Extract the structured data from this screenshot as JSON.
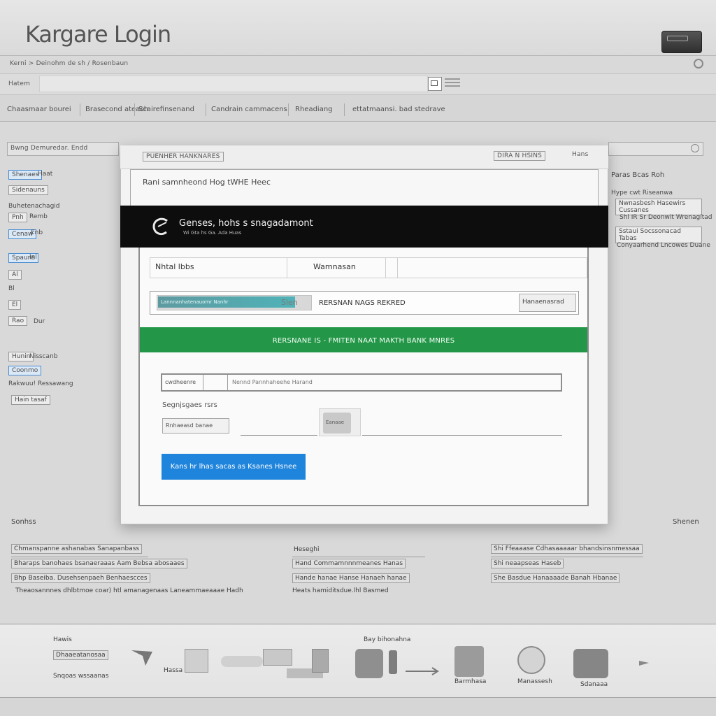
{
  "header": {
    "app_title": "Kargare Login",
    "breadcrumb": "Kerni > Deinohm de sh / Rosenbaun",
    "search_label": "Hatem",
    "search_placeholder": ""
  },
  "nav": {
    "tabs": [
      "Chaasmaar bourei",
      "Brasecond ateach",
      "Scairefinsenand",
      "Candrain cammacens",
      "Rheadiang",
      "ettatmaansi. bad stedrave"
    ]
  },
  "left_sidebar": {
    "filter": "Bwng Demuredar. Endd",
    "items": [
      "Shenaes",
      "Haat",
      "Sidenauns",
      "Buhetenachagid",
      "Pnh",
      "Remb",
      "Cenaw",
      "Enb",
      "Spauns",
      "Inl",
      "Al",
      "Bl",
      "El",
      "Rao",
      "Dur",
      "Hunin",
      "Nisscanb",
      "Coonmo",
      "Rakwuu! Ressawang",
      "Hain tasaf"
    ]
  },
  "right_sidebar": {
    "heading": "Paras Bcas Roh",
    "items": [
      "Hype cwt Riseanwa",
      "Nwnasbesh Hasewirs Cussanes",
      "Shl IR Sr Deonwit Wrenagitad",
      "Sstaui Socssonacad Tabas",
      "Conyaarhend Lncowes Duane"
    ]
  },
  "modal": {
    "tab_label": "PUENHER HANKNARES",
    "mode": "DIRA N HSINS",
    "close_label": "Hans",
    "heading": "Rani samnheond Hog tWHE Heec",
    "brand_name": "Genses, hohs  s  snagadamont",
    "brand_tagline": "Wi Gta hs Ga. Ada Huas",
    "username_label": "Nhtal lbbs",
    "workspace_label": "Wamnasan",
    "progress_text": "Lannnanhatenauomr Nanhr",
    "progress_value": 0.9,
    "progress_pct_label": "Slen",
    "row2_label": "RERSNAN NAGS REKRED",
    "row2_button": "Hanaenasrad",
    "status_text": "RERSNANE IS - FMITEN  NAAT MAKTH BANK MNRES",
    "password_label": "cwdheenre",
    "password_placeholder": "Nennd Pannhaheehe Harand",
    "remember_label": "Segnjsgaes rsrs",
    "remember_field": "Rnhaeasd banae",
    "captcha_text": "Eanaae",
    "login_button": "Kans hr lhas sacas as Ksanes Hsnee"
  },
  "lower": {
    "left_title": "Sonhss",
    "right_title": "Shenen",
    "col1": [
      "Chmanspanne ashanabas Sanapanbass",
      "Bharaps banohaes bsanaeraaas Aam Bebsa abosaaes",
      "Bhp Baseiba. Dusehsenpaeh Benhaescces",
      "Theaosannnes dhlbtmoe coar) htl amanagenaas Laneammaeaaae Hadh"
    ],
    "col2": [
      "Heseghi",
      "Hand  Commamnnnmeanes  Hanas",
      "Hande hanae Hanse Hanaeh hanae",
      "Heats hamiditsdue.lhl Basmed"
    ],
    "col3": [
      "Shi Ffeaaase Cdhasaaaaar bhandsinsnmessaa",
      "Shi neaapseas Haseb",
      "She Basdue Hanaaaade Banah Hbanae"
    ]
  },
  "footer": {
    "left_label": "Hawis",
    "left_box": "Dhaaeatanosaa",
    "left_sub": "Snqoas wssaanas",
    "mid_label": "Hassa",
    "center_title": "Bay bihonahna",
    "captions": [
      "Barmhasa",
      "Manassesh",
      "Sdanaaa"
    ]
  },
  "colors": {
    "status_green": "#239648",
    "primary_blue": "#1f84db",
    "banner_black": "#0d0d0d"
  }
}
